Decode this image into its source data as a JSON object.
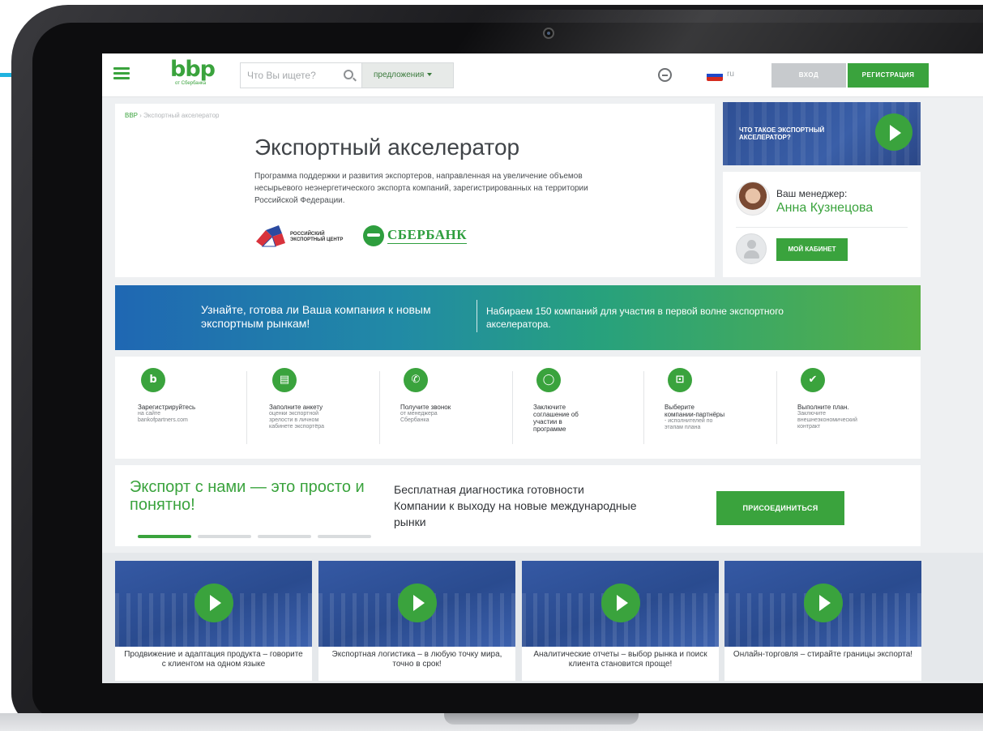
{
  "header": {
    "logo_main": "bbp",
    "logo_sub": "от Сбербанка",
    "search_placeholder": "Что Вы ищете?",
    "offers_label": "предложения",
    "lang": "ru",
    "login_label": "ВХОД",
    "register_label": "РЕГИСТРАЦИЯ"
  },
  "breadcrumb": {
    "home": "BBP",
    "separator": "›",
    "current": "Экспортный акселератор"
  },
  "hero": {
    "title": "Экспортный акселератор",
    "description": "Программа поддержки и развития экспортеров, направленная на увеличение объемов несырьевого неэнергетического экспорта компаний, зарегистрированных на территории Российской Федерации.",
    "partner1_line1": "РОССИЙСКИЙ",
    "partner1_line2": "ЭКСПОРТНЫЙ ЦЕНТР",
    "partner2": "СБЕРБАНК"
  },
  "video_card": {
    "title_line1": "ЧТО ТАКОЕ ЭКСПОРТНЫЙ",
    "title_line2": "АКСЕЛЕРАТОР?"
  },
  "manager": {
    "label": "Ваш менеджер:",
    "name": "Анна Кузнецова",
    "cabinet_label": "МОЙ КАБИНЕТ"
  },
  "banner": {
    "left": "Узнайте, готова ли Ваша компания к новым экспортным рынкам!",
    "right": "Набираем 150 компаний для участия в первой волне экспортного акселератора."
  },
  "steps": [
    {
      "icon": "b-logo-icon",
      "title": "Зарегистрируйтесь",
      "desc_l1": "на сайте",
      "desc_l2": "bankofpartners.com",
      "desc_l3": "",
      "desc_l4": ""
    },
    {
      "icon": "document-icon",
      "title": "Заполните анкету",
      "desc_l1": "оценки экспортной",
      "desc_l2": "зрелости в личном",
      "desc_l3": "кабинете экспортёра",
      "desc_l4": ""
    },
    {
      "icon": "phone-icon",
      "title": "Получите звонок",
      "desc_l1": "от менеджера",
      "desc_l2": "Сбербанка",
      "desc_l3": "",
      "desc_l4": ""
    },
    {
      "icon": "agreement-icon",
      "title": "Заключите",
      "title_l2": "соглашение об",
      "title_l3": "участии в",
      "title_l4": "программе"
    },
    {
      "icon": "briefcase-icon",
      "title": "Выберите",
      "title_l2": "компании-партнёры",
      "desc_l1": "- исполнителей по",
      "desc_l2": "этапам плана"
    },
    {
      "icon": "check-icon",
      "title": "Выполните план.",
      "desc_l1": "Заключите",
      "desc_l2": "внешнеэкономический",
      "desc_l3": "контракт"
    }
  ],
  "promo": {
    "title": "Экспорт с нами — это просто и понятно!",
    "text": "Бесплатная диагностика готовности Компании к выходу на новые международные рынки",
    "join_label": "ПРИСОЕДИНИТЬСЯ",
    "active_slide": 1,
    "slide_count": 4
  },
  "videos": [
    {
      "caption": "Продвижение и адаптация продукта – говорите с клиентом на одном языке"
    },
    {
      "caption": "Экспортная логистика – в любую точку мира, точно в срок!"
    },
    {
      "caption": "Аналитические отчеты – выбор рынка и поиск клиента становится проще!"
    },
    {
      "caption": "Онлайн-торговля – стирайте границы экспорта!"
    }
  ],
  "colors": {
    "brand_green": "#3aa33d",
    "banner_blue": "#1f67b3",
    "flag": [
      "#ffffff",
      "#1f48c8",
      "#d52b1e"
    ]
  }
}
